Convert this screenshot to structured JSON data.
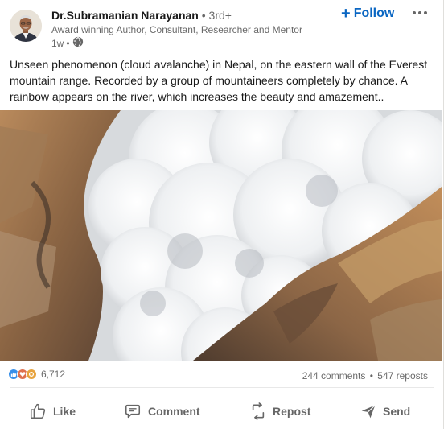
{
  "post": {
    "author": {
      "name": "Dr.Subramanian Narayanan",
      "degree": "3rd+",
      "headline": "Award winning Author, Consultant, Researcher and Mentor",
      "time": "1w"
    },
    "follow_label": "Follow",
    "text": "Unseen phenomenon (cloud avalanche) in Nepal, on the eastern wall of the Everest mountain range. Recorded by a group of mountaineers completely by chance. A rainbow appears on the river, which increases the beauty and amazement..",
    "reactions": {
      "count": "6,712",
      "types": [
        "like-icon",
        "love-icon",
        "support-icon"
      ]
    },
    "stats": {
      "comments": "244 comments",
      "reposts": "547 reposts",
      "separator": "•"
    }
  },
  "actions": {
    "like": "Like",
    "comment": "Comment",
    "repost": "Repost",
    "send": "Send"
  },
  "colors": {
    "accent": "#0a66c2",
    "like_blue": "#378fe9",
    "love_red": "#df704d",
    "support_yellow": "#e7a33e"
  }
}
